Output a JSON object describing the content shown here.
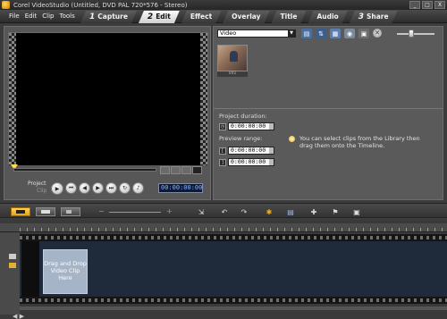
{
  "titlebar": {
    "title": "Corel VideoStudio (Untitled, DVD PAL 720*576 - Stereo)",
    "buttons": [
      "_",
      "□",
      "X"
    ]
  },
  "menubar": {
    "menus": [
      "File",
      "Edit",
      "Clip",
      "Tools"
    ],
    "steps": [
      {
        "num": "1",
        "label": "Capture",
        "active": false
      },
      {
        "num": "2",
        "label": "Edit",
        "active": true
      },
      {
        "num": "",
        "label": "Effect",
        "active": false
      },
      {
        "num": "",
        "label": "Overlay",
        "active": false
      },
      {
        "num": "",
        "label": "Title",
        "active": false
      },
      {
        "num": "",
        "label": "Audio",
        "active": false
      },
      {
        "num": "3",
        "label": "Share",
        "active": false
      }
    ]
  },
  "preview": {
    "project_label": "Project",
    "clip_label": "Clip",
    "timecode": "00:00:00:00"
  },
  "library": {
    "category": "Video",
    "clip_name": "V01",
    "project_duration_label": "Project duration:",
    "project_duration": "0:00:00:00",
    "preview_range_label": "Preview range:",
    "preview_start": "0:00:00:00",
    "preview_end": "0:00:00:00",
    "hint": "You can select clips from the Library then drag them onto the Timeline."
  },
  "timeline": {
    "drop_text": "Drag and Drop Video Clip Here",
    "nav": "◀ ▶"
  },
  "colors": {
    "accent": "#f2b52a",
    "timecode_bg": "#0a1a3a",
    "drop_box": "#a6b4c8"
  }
}
